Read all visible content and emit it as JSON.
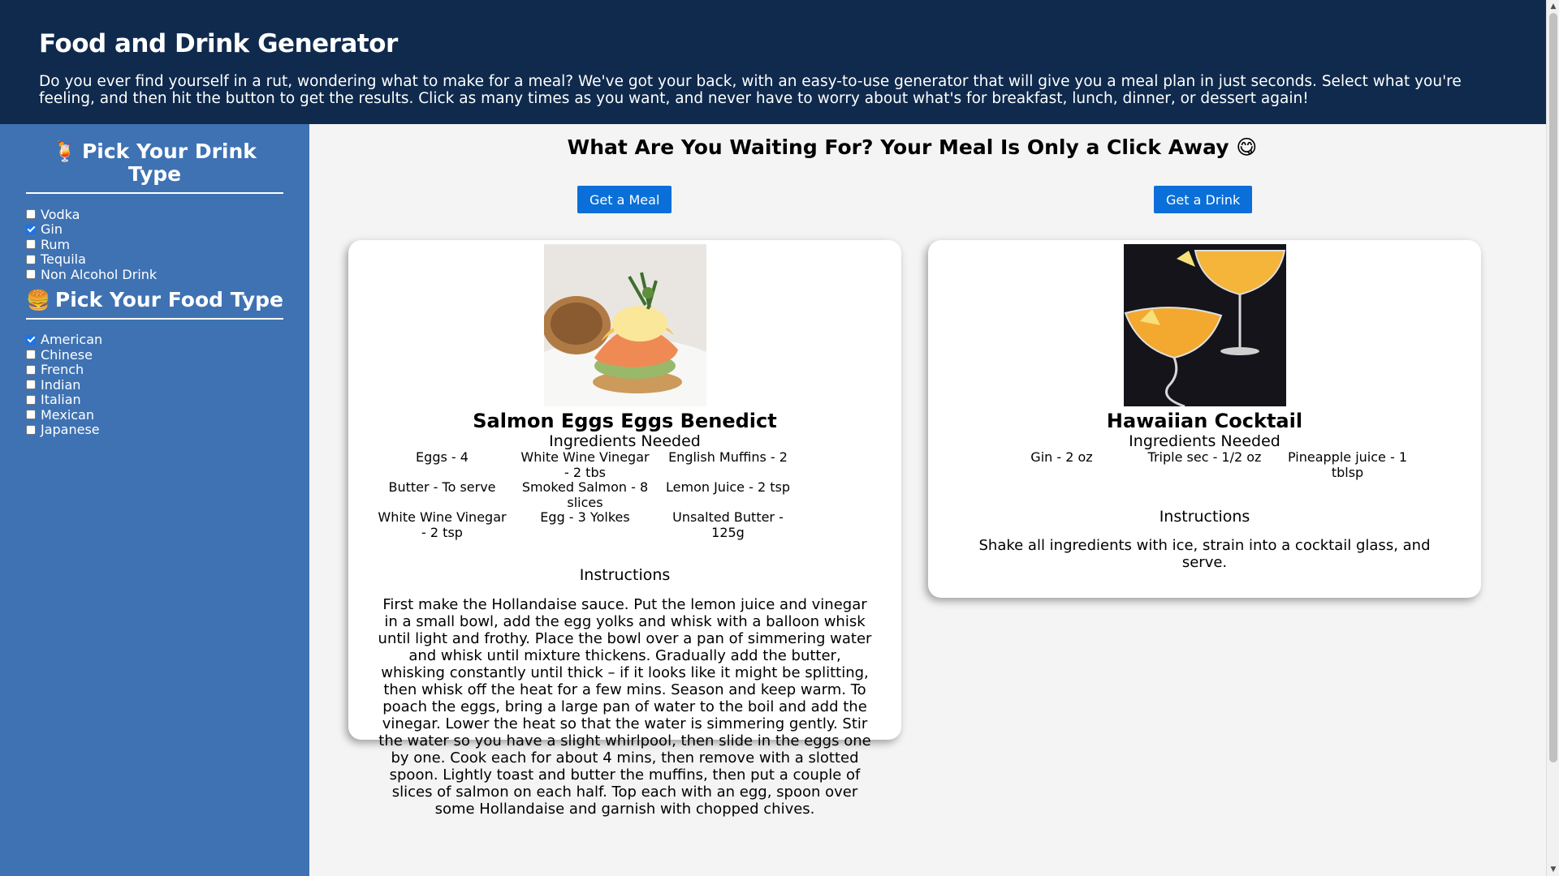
{
  "header": {
    "title": "Food and Drink Generator",
    "description": "Do you ever find yourself in a rut, wondering what to make for a meal? We've got your back, with an easy-to-use generator that will give you a meal plan in just seconds. Select what you're feeling, and then hit the button to get the results. Click as many times as you want, and never have to worry about what's for breakfast, lunch, dinner, or dessert again!"
  },
  "sidebar": {
    "drink_title": "Pick Your Drink Type",
    "drink_emoji": "🍹",
    "drink_options": [
      {
        "label": "Vodka",
        "checked": false
      },
      {
        "label": "Gin",
        "checked": true
      },
      {
        "label": "Rum",
        "checked": false
      },
      {
        "label": "Tequila",
        "checked": false
      },
      {
        "label": "Non Alcohol Drink",
        "checked": false
      }
    ],
    "food_title": "Pick Your Food Type",
    "food_emoji": "🍔",
    "food_options": [
      {
        "label": "American",
        "checked": true
      },
      {
        "label": "Chinese",
        "checked": false
      },
      {
        "label": "French",
        "checked": false
      },
      {
        "label": "Indian",
        "checked": false
      },
      {
        "label": "Italian",
        "checked": false
      },
      {
        "label": "Mexican",
        "checked": false
      },
      {
        "label": "Japanese",
        "checked": false
      }
    ]
  },
  "main": {
    "heading": "What Are You Waiting For? Your Meal Is Only a Click Away",
    "heading_emoji": "😋",
    "meal_button": "Get a Meal",
    "drink_button": "Get a Drink"
  },
  "meal": {
    "name": "Salmon Eggs Eggs Benedict",
    "ingredients_heading": "Ingredients Needed",
    "ingredients": [
      "Eggs - 4",
      "White Wine Vinegar - 2 tbs",
      "English Muffins - 2",
      "Butter - To serve",
      "Smoked Salmon - 8 slices",
      "Lemon Juice - 2 tsp",
      "White Wine Vinegar - 2 tsp",
      "Egg - 3 Yolkes",
      "Unsalted Butter - 125g"
    ],
    "instructions_heading": "Instructions",
    "instructions": "First make the Hollandaise sauce. Put the lemon juice and vinegar in a small bowl, add the egg yolks and whisk with a balloon whisk until light and frothy. Place the bowl over a pan of simmering water and whisk until mixture thickens. Gradually add the butter, whisking constantly until thick – if it looks like it might be splitting, then whisk off the heat for a few mins. Season and keep warm. To poach the eggs, bring a large pan of water to the boil and add the vinegar. Lower the heat so that the water is simmering gently. Stir the water so you have a slight whirlpool, then slide in the eggs one by one. Cook each for about 4 mins, then remove with a slotted spoon. Lightly toast and butter the muffins, then put a couple of slices of salmon on each half. Top each with an egg, spoon over some Hollandaise and garnish with chopped chives."
  },
  "drink": {
    "name": "Hawaiian Cocktail",
    "ingredients_heading": "Ingredients Needed",
    "ingredients": [
      "Gin - 2 oz",
      "Triple sec - 1/2 oz",
      "Pineapple juice - 1 tblsp"
    ],
    "instructions_heading": "Instructions",
    "instructions": "Shake all ingredients with ice, strain into a cocktail glass, and serve."
  }
}
